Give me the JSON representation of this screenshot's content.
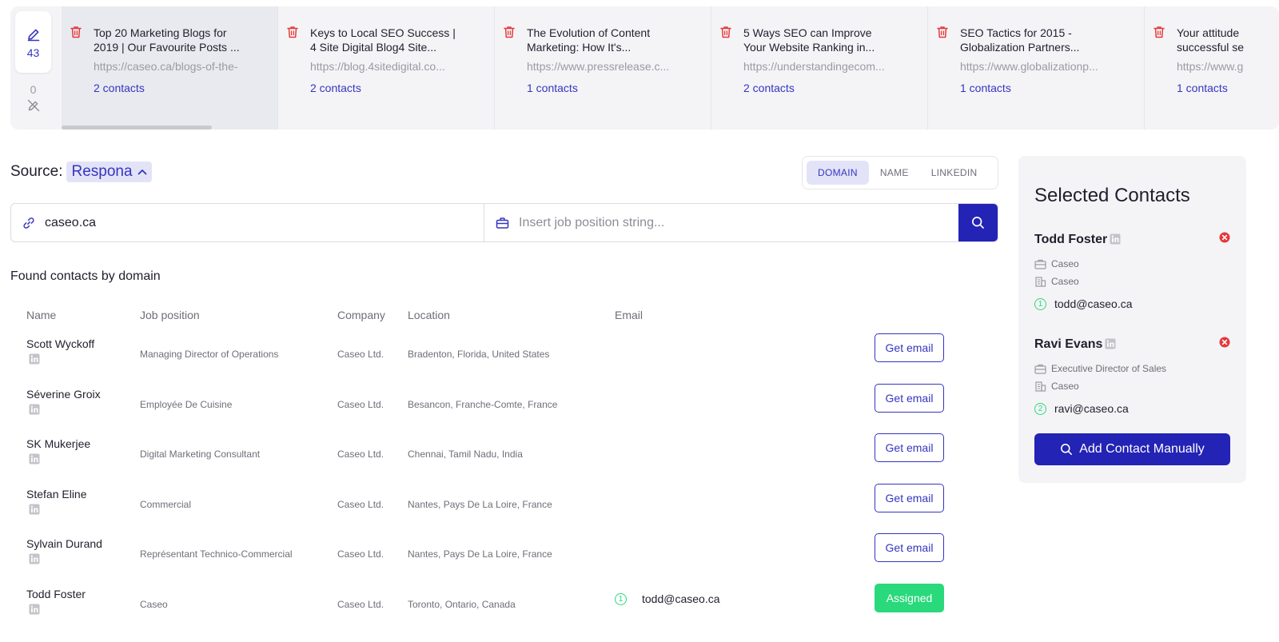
{
  "counters": {
    "active_count": "43",
    "inactive_count": "0"
  },
  "pages": [
    {
      "title": "Top 20 Marketing Blogs for\n2019 | Our Favourite Posts ...",
      "url": "https://caseo.ca/blogs-of-the-",
      "contacts": "2 contacts",
      "active": true
    },
    {
      "title": "Keys to Local SEO Success |\n4 Site Digital Blog4 Site...",
      "url": "https://blog.4sitedigital.co...",
      "contacts": "2 contacts",
      "active": false
    },
    {
      "title": "The Evolution of Content\nMarketing: How It's...",
      "url": "https://www.pressrelease.c...",
      "contacts": "1 contacts",
      "active": false
    },
    {
      "title": "5 Ways SEO can Improve\nYour Website Ranking in...",
      "url": "https://understandingecom...",
      "contacts": "2 contacts",
      "active": false
    },
    {
      "title": "SEO Tactics for 2015 -\nGlobalization Partners...",
      "url": "https://www.globalizationp...",
      "contacts": "1 contacts",
      "active": false
    },
    {
      "title": "Your attitude\nsuccessful se",
      "url": "https://www.g",
      "contacts": "1 contacts",
      "active": false
    }
  ],
  "source": {
    "label": "Source:",
    "value": "Respona"
  },
  "tabs": {
    "domain": "DOMAIN",
    "name": "NAME",
    "linkedin": "LINKEDIN"
  },
  "search": {
    "domain_value": "caseo.ca",
    "job_placeholder": "Insert job position string..."
  },
  "found_label": "Found contacts by domain",
  "table": {
    "headers": {
      "name": "Name",
      "job": "Job position",
      "company": "Company",
      "location": "Location",
      "email": "Email"
    },
    "rows": [
      {
        "name": "Scott Wyckoff",
        "job": "Managing Director of Operations",
        "company": "Caseo Ltd.",
        "location": "Bradenton, Florida, United States",
        "action": "Get email"
      },
      {
        "name": "Séverine Groix",
        "job": "Employée De Cuisine",
        "company": "Caseo Ltd.",
        "location": "Besancon, Franche-Comte, France",
        "action": "Get email"
      },
      {
        "name": "SK Mukerjee",
        "job": "Digital Marketing Consultant",
        "company": "Caseo Ltd.",
        "location": "Chennai, Tamil Nadu, India",
        "action": "Get email"
      },
      {
        "name": "Stefan Eline",
        "job": "Commercial",
        "company": "Caseo Ltd.",
        "location": "Nantes, Pays De La Loire, France",
        "action": "Get email"
      },
      {
        "name": "Sylvain Durand",
        "job": "Représentant Technico-Commercial",
        "company": "Caseo Ltd.",
        "location": "Nantes, Pays De La Loire, France",
        "action": "Get email"
      },
      {
        "name": "Todd Foster",
        "job": "Caseo",
        "company": "Caseo Ltd.",
        "location": "Toronto, Ontario, Canada",
        "email_index": "1",
        "email": "todd@caseo.ca",
        "action": "Assigned"
      }
    ]
  },
  "panel": {
    "title": "Selected Contacts",
    "contacts": [
      {
        "name": "Todd Foster",
        "position": "Caseo",
        "company": "Caseo",
        "index": "1",
        "email": "todd@caseo.ca"
      },
      {
        "name": "Ravi Evans",
        "position": "Executive Director of Sales",
        "company": "Caseo",
        "index": "2",
        "email": "ravi@caseo.ca"
      }
    ],
    "add_button": "Add Contact Manually"
  },
  "colors": {
    "accent": "#2323b5",
    "link": "#3535c0",
    "success": "#29d97c",
    "danger": "#e5383b"
  }
}
